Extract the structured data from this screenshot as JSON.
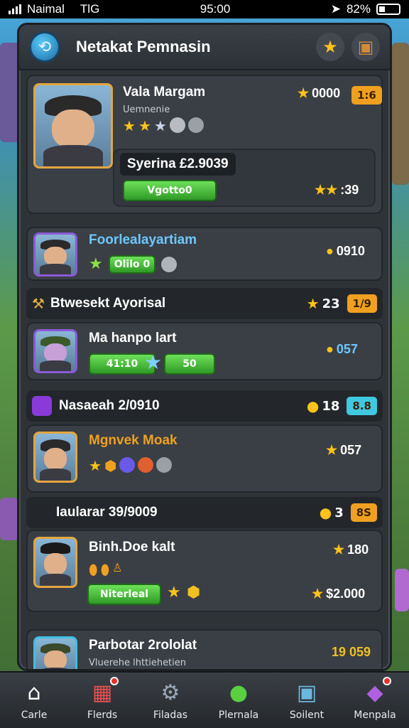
{
  "status": {
    "carrier": "Naimal",
    "network": "TlG",
    "time": "95:00",
    "battery": "82%"
  },
  "header": {
    "title": "Netakat Pemnasin",
    "logo_icon": "globe-icon",
    "star_icon": "star-icon",
    "chest_icon": "treasure-chest-icon"
  },
  "cards": [
    {
      "name": "Vala Margam",
      "subtitle": "Uemnenie",
      "score": "0000",
      "badge": "1:6",
      "tag": "Syerina £2.9039",
      "button": "Vgotto0",
      "right_score": ":39"
    },
    {
      "name": "Foorlealayartiam",
      "pill": "Olilo 0",
      "score": "0910"
    },
    {
      "section": "Btwesekt Ayorisal",
      "section_score": "23",
      "section_badge": "1/9"
    },
    {
      "name": "Ma hanpo lart",
      "pill_left": "41:10",
      "pill_right": "50",
      "score": "057"
    },
    {
      "section": "Nasaeah 2/0910",
      "section_score": "18",
      "section_badge": "8.8"
    },
    {
      "name": "Mgnvek Moak",
      "score": "057"
    },
    {
      "section": "Iaularar 39/9009",
      "section_score": "3",
      "section_badge": "8S"
    },
    {
      "name": "Binh.Doe kalt",
      "score": "180",
      "button": "Niterleal",
      "right_score": "$2.000"
    },
    {
      "name": "Parbotar 2rololat",
      "subtitle": "Vluerehe lhttiehetien",
      "score": "19 059"
    }
  ],
  "nav": [
    {
      "label": "Carle",
      "icon": "home-icon"
    },
    {
      "label": "Flerds",
      "icon": "gift-icon"
    },
    {
      "label": "Filadas",
      "icon": "robot-icon"
    },
    {
      "label": "Plernala",
      "icon": "green-orb-icon"
    },
    {
      "label": "Soilent",
      "icon": "crate-icon"
    },
    {
      "label": "Menpala",
      "icon": "gem-cube-icon"
    }
  ]
}
